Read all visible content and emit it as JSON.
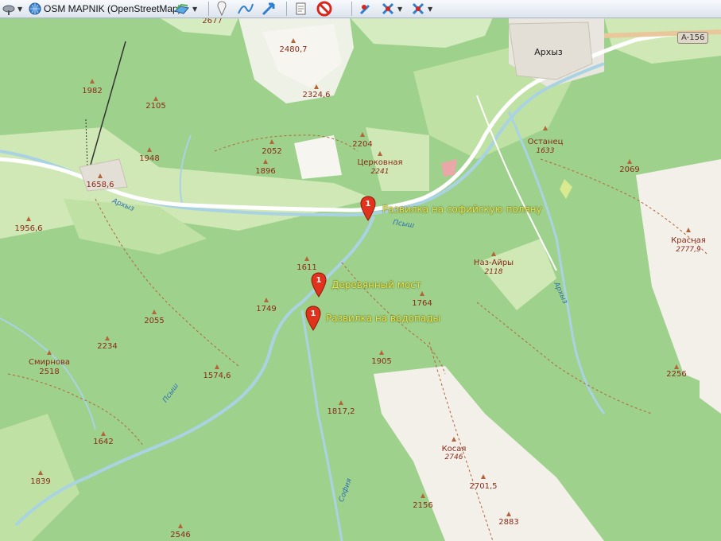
{
  "toolbar": {
    "layer_label": "OSM MAPNIK (OpenStreetMap)"
  },
  "road_shield": "A-156",
  "town": "Архыз",
  "peaks": [
    {
      "name": "",
      "ele": "2677",
      "italic": false
    },
    {
      "name": "",
      "ele": "2480,7",
      "italic": false
    },
    {
      "name": "",
      "ele": "1982",
      "italic": false
    },
    {
      "name": "",
      "ele": "2105",
      "italic": false
    },
    {
      "name": "",
      "ele": "2324,6",
      "italic": false
    },
    {
      "name": "",
      "ele": "2204",
      "italic": false
    },
    {
      "name": "",
      "ele": "2052",
      "italic": false
    },
    {
      "name": "",
      "ele": "1948",
      "italic": false
    },
    {
      "name": "",
      "ele": "1896",
      "italic": false
    },
    {
      "name": "Церковная",
      "ele": "2241",
      "italic": true
    },
    {
      "name": "Останец",
      "ele": "1633",
      "italic": true
    },
    {
      "name": "",
      "ele": "2069",
      "italic": false
    },
    {
      "name": "",
      "ele": "1658,6",
      "italic": false
    },
    {
      "name": "",
      "ele": "1956,6",
      "italic": false
    },
    {
      "name": "Красная",
      "ele": "2777,9",
      "italic": true
    },
    {
      "name": "Наз-Айры",
      "ele": "2118",
      "italic": true
    },
    {
      "name": "",
      "ele": "1611",
      "italic": false
    },
    {
      "name": "",
      "ele": "1764",
      "italic": false
    },
    {
      "name": "",
      "ele": "1749",
      "italic": false
    },
    {
      "name": "",
      "ele": "2055",
      "italic": false
    },
    {
      "name": "",
      "ele": "2234",
      "italic": false
    },
    {
      "name": "Смирнова",
      "ele": "2518",
      "italic": false
    },
    {
      "name": "",
      "ele": "1905",
      "italic": false
    },
    {
      "name": "",
      "ele": "1574,6",
      "italic": false
    },
    {
      "name": "",
      "ele": "2256",
      "italic": false
    },
    {
      "name": "",
      "ele": "1817,2",
      "italic": false
    },
    {
      "name": "Косая",
      "ele": "2746",
      "italic": true
    },
    {
      "name": "",
      "ele": "1642",
      "italic": false
    },
    {
      "name": "",
      "ele": "2701,5",
      "italic": false
    },
    {
      "name": "",
      "ele": "1839",
      "italic": false
    },
    {
      "name": "",
      "ele": "2156",
      "italic": false
    },
    {
      "name": "",
      "ele": "2883",
      "italic": false
    },
    {
      "name": "",
      "ele": "2546",
      "italic": false
    }
  ],
  "rivers": [
    "Архыз",
    "Псыш",
    "Архыз",
    "Псыш",
    "София"
  ],
  "waypoints": [
    {
      "number": "1",
      "label": "Развилка на софийскую поляну"
    },
    {
      "number": "1",
      "label": "Деревянный мост"
    },
    {
      "number": "1",
      "label": "Развилка на водопады"
    }
  ],
  "colors": {
    "forest": "#9ed18b",
    "meadow": "#cfe8b6",
    "bare_rock": "#f1eee8",
    "river": "#a9d3e3",
    "road": "#ffffff",
    "pin": "#e0321c",
    "pin_label": "#e8e84a"
  }
}
